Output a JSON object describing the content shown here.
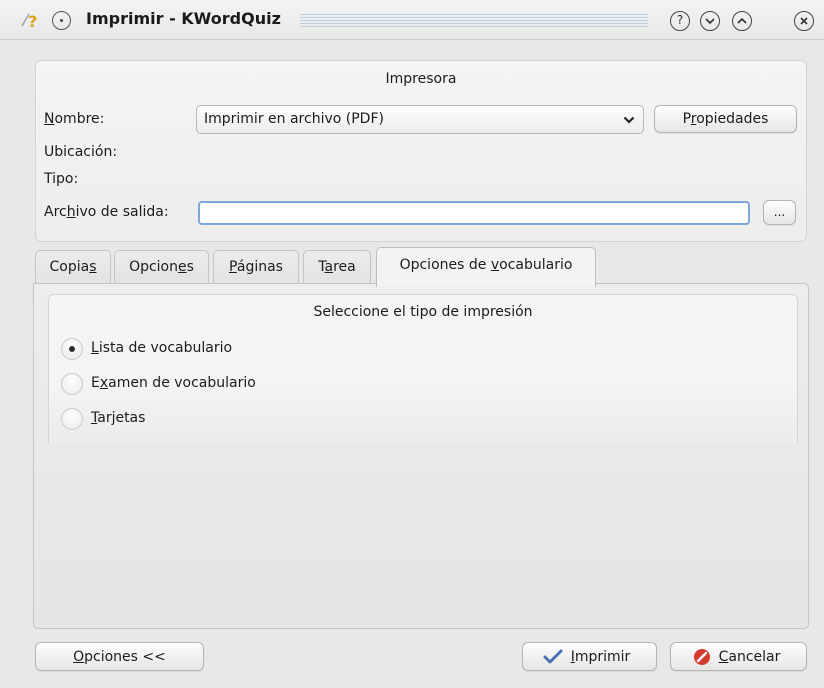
{
  "window": {
    "title": "Imprimir - KWordQuiz",
    "app_icon": "kwordquiz-app-icon",
    "buttons": {
      "help": "?",
      "minimize": "chevron-down-icon",
      "maximize": "chevron-up-icon",
      "close": "close-icon"
    }
  },
  "printer": {
    "group_title": "Impresora",
    "name_label_pre": "",
    "name_label_ul": "N",
    "name_label_post": "ombre:",
    "name_value": "Imprimir en archivo (PDF)",
    "properties_pre": "P",
    "properties_ul": "r",
    "properties_post": "opiedades",
    "location_label": "Ubicación:",
    "type_label": "Tipo:",
    "output_pre": "Arc",
    "output_ul": "h",
    "output_post": "ivo de salida:",
    "output_value": "",
    "browse_label": "..."
  },
  "tabs": [
    {
      "pre": "Copia",
      "ul": "s",
      "post": ""
    },
    {
      "pre": "Opcion",
      "ul": "e",
      "post": "s"
    },
    {
      "pre": "",
      "ul": "P",
      "post": "áginas"
    },
    {
      "pre": "T",
      "ul": "a",
      "post": "rea"
    },
    {
      "pre": "Opciones de ",
      "ul": "v",
      "post": "ocabulario"
    }
  ],
  "vocab": {
    "group_title": "Seleccione el tipo de impresión",
    "options": [
      {
        "pre": "",
        "ul": "L",
        "post": "ista de vocabulario",
        "checked": true
      },
      {
        "pre": "E",
        "ul": "x",
        "post": "amen de vocabulario",
        "checked": false
      },
      {
        "pre": "",
        "ul": "T",
        "post": "arjetas",
        "checked": false
      }
    ]
  },
  "footer": {
    "options_pre": "",
    "options_ul": "O",
    "options_post": "pciones <<",
    "print_pre": "",
    "print_ul": "I",
    "print_post": "mprimir",
    "cancel_pre": "",
    "cancel_ul": "C",
    "cancel_post": "ancelar",
    "print_icon": "checkmark-icon",
    "cancel_icon": "cancel-icon",
    "colors": {
      "accent": "#7fa6d8",
      "cancel_red": "#d23b2b",
      "check_blue": "#4a70b8"
    }
  }
}
